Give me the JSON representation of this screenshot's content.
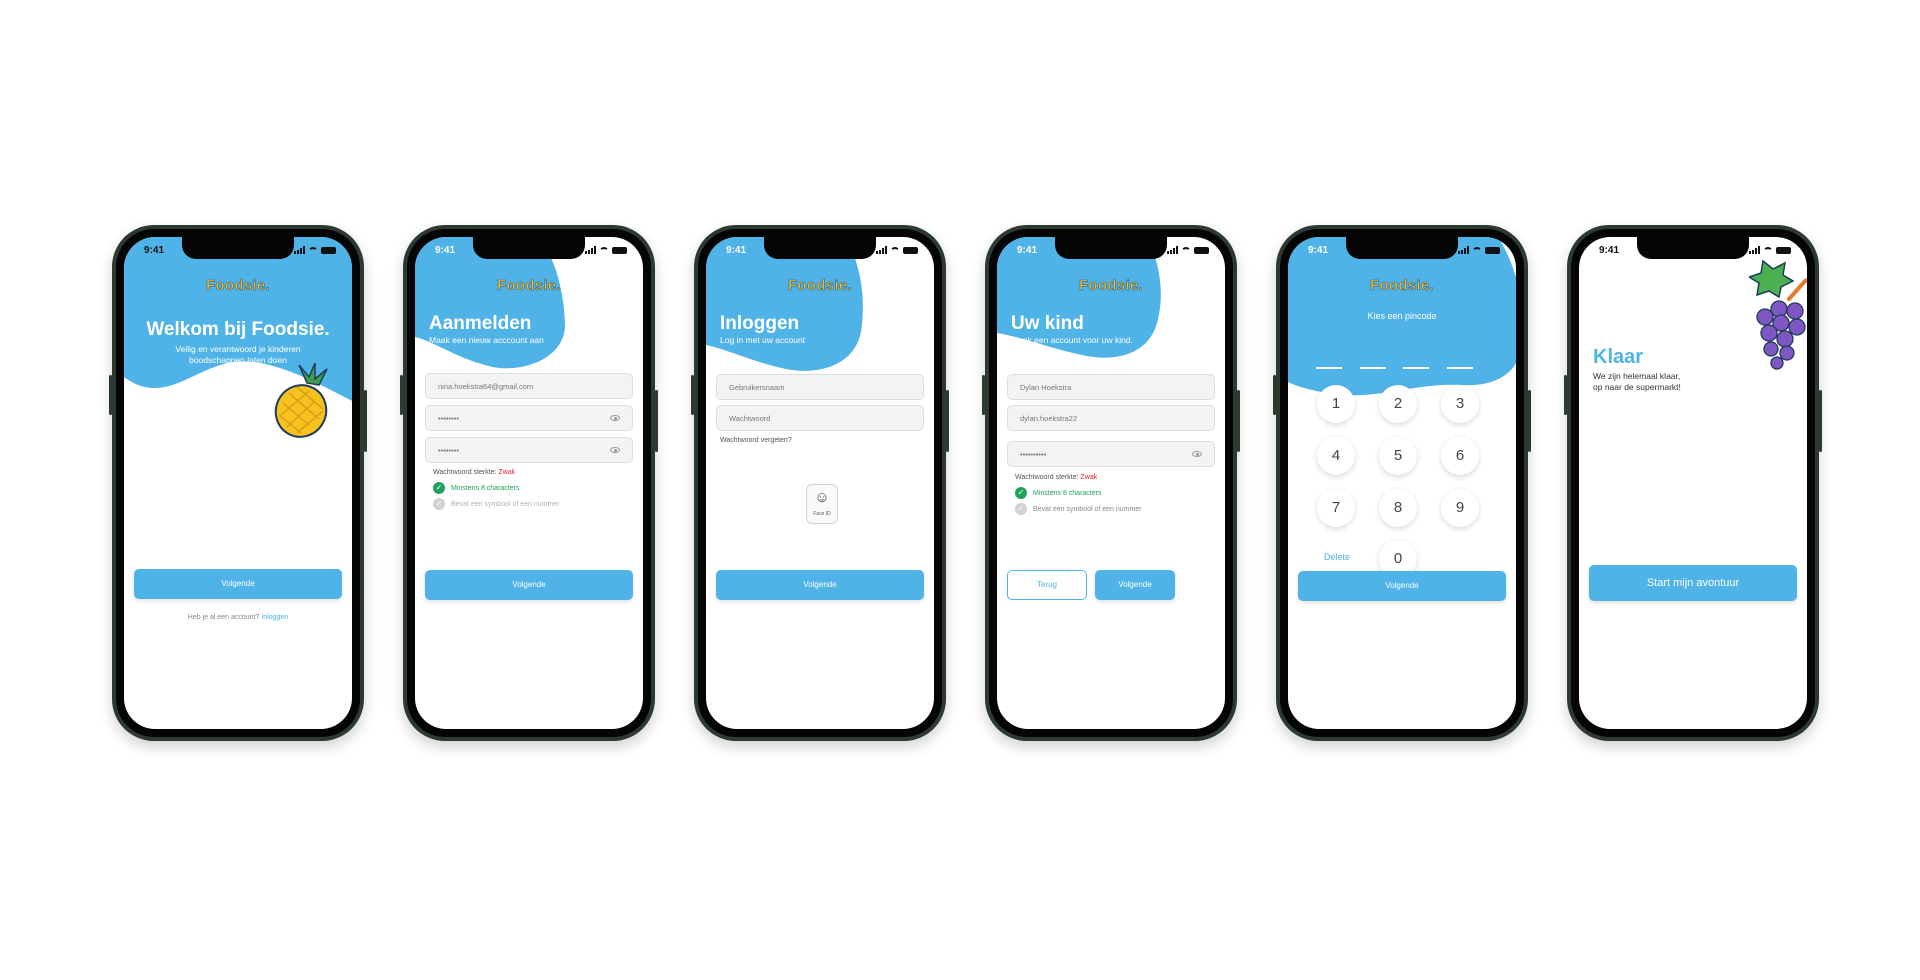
{
  "status_time": "9:41",
  "logo": "Foodsie.",
  "screen1": {
    "title": "Welkom bij Foodsie.",
    "subtitle_line1": "Veilig en verantwoord je kinderen",
    "subtitle_line2": "boodschappen laten doen",
    "button": "Volgende",
    "footer_question": "Heb je al een account?",
    "footer_link": "Inloggen",
    "illustration": "pineapple"
  },
  "screen2": {
    "title": "Aanmelden",
    "subtitle": "Maak een nieuw acccount aan",
    "email_value": "nina.hoekstra64@gmail.com",
    "password_value": "••••••••",
    "confirm_value": "••••••••",
    "strength_label": "Wachtwoord sterkte:",
    "strength_value": "Zwak",
    "rule1": "Minstens 8 characters",
    "rule2": "Bevat een symbool of een nummer",
    "button": "Volgende"
  },
  "screen3": {
    "title": "Inloggen",
    "subtitle": "Log in met uw account",
    "username_placeholder": "Gebruikersnaam",
    "password_placeholder": "Wachtwoord",
    "forgot": "Wachtwoord vergeten?",
    "faceid_label": "Face ID",
    "button": "Volgende"
  },
  "screen4": {
    "title": "Uw kind",
    "subtitle": "Maak een account voor uw kind.",
    "name_value": "Dylan Hoekstra",
    "username_value": "dylan.hoekstra22",
    "password_value": "••••••••••",
    "strength_label": "Wachtwoord sterkte:",
    "strength_value": "Zwak",
    "rule1": "Minstens 8 characters",
    "rule2": "Bevat een symbool of een nummer",
    "back_button": "Terug",
    "button": "Volgende"
  },
  "screen5": {
    "title": "Kies een pincode",
    "keys": [
      "1",
      "2",
      "3",
      "4",
      "5",
      "6",
      "7",
      "8",
      "9",
      "0"
    ],
    "delete": "Delete",
    "button": "Volgende"
  },
  "screen6": {
    "title": "Klaar",
    "subtitle_line1": "We zijn helemaal klaar,",
    "subtitle_line2": "op naar de supermarkt!",
    "button": "Start mijn avontuur",
    "illustration": "grapes"
  },
  "colors": {
    "accent": "#4fb3e8",
    "logo_yellow": "#f5c02a",
    "success": "#1fa35b",
    "error": "#e02424"
  }
}
